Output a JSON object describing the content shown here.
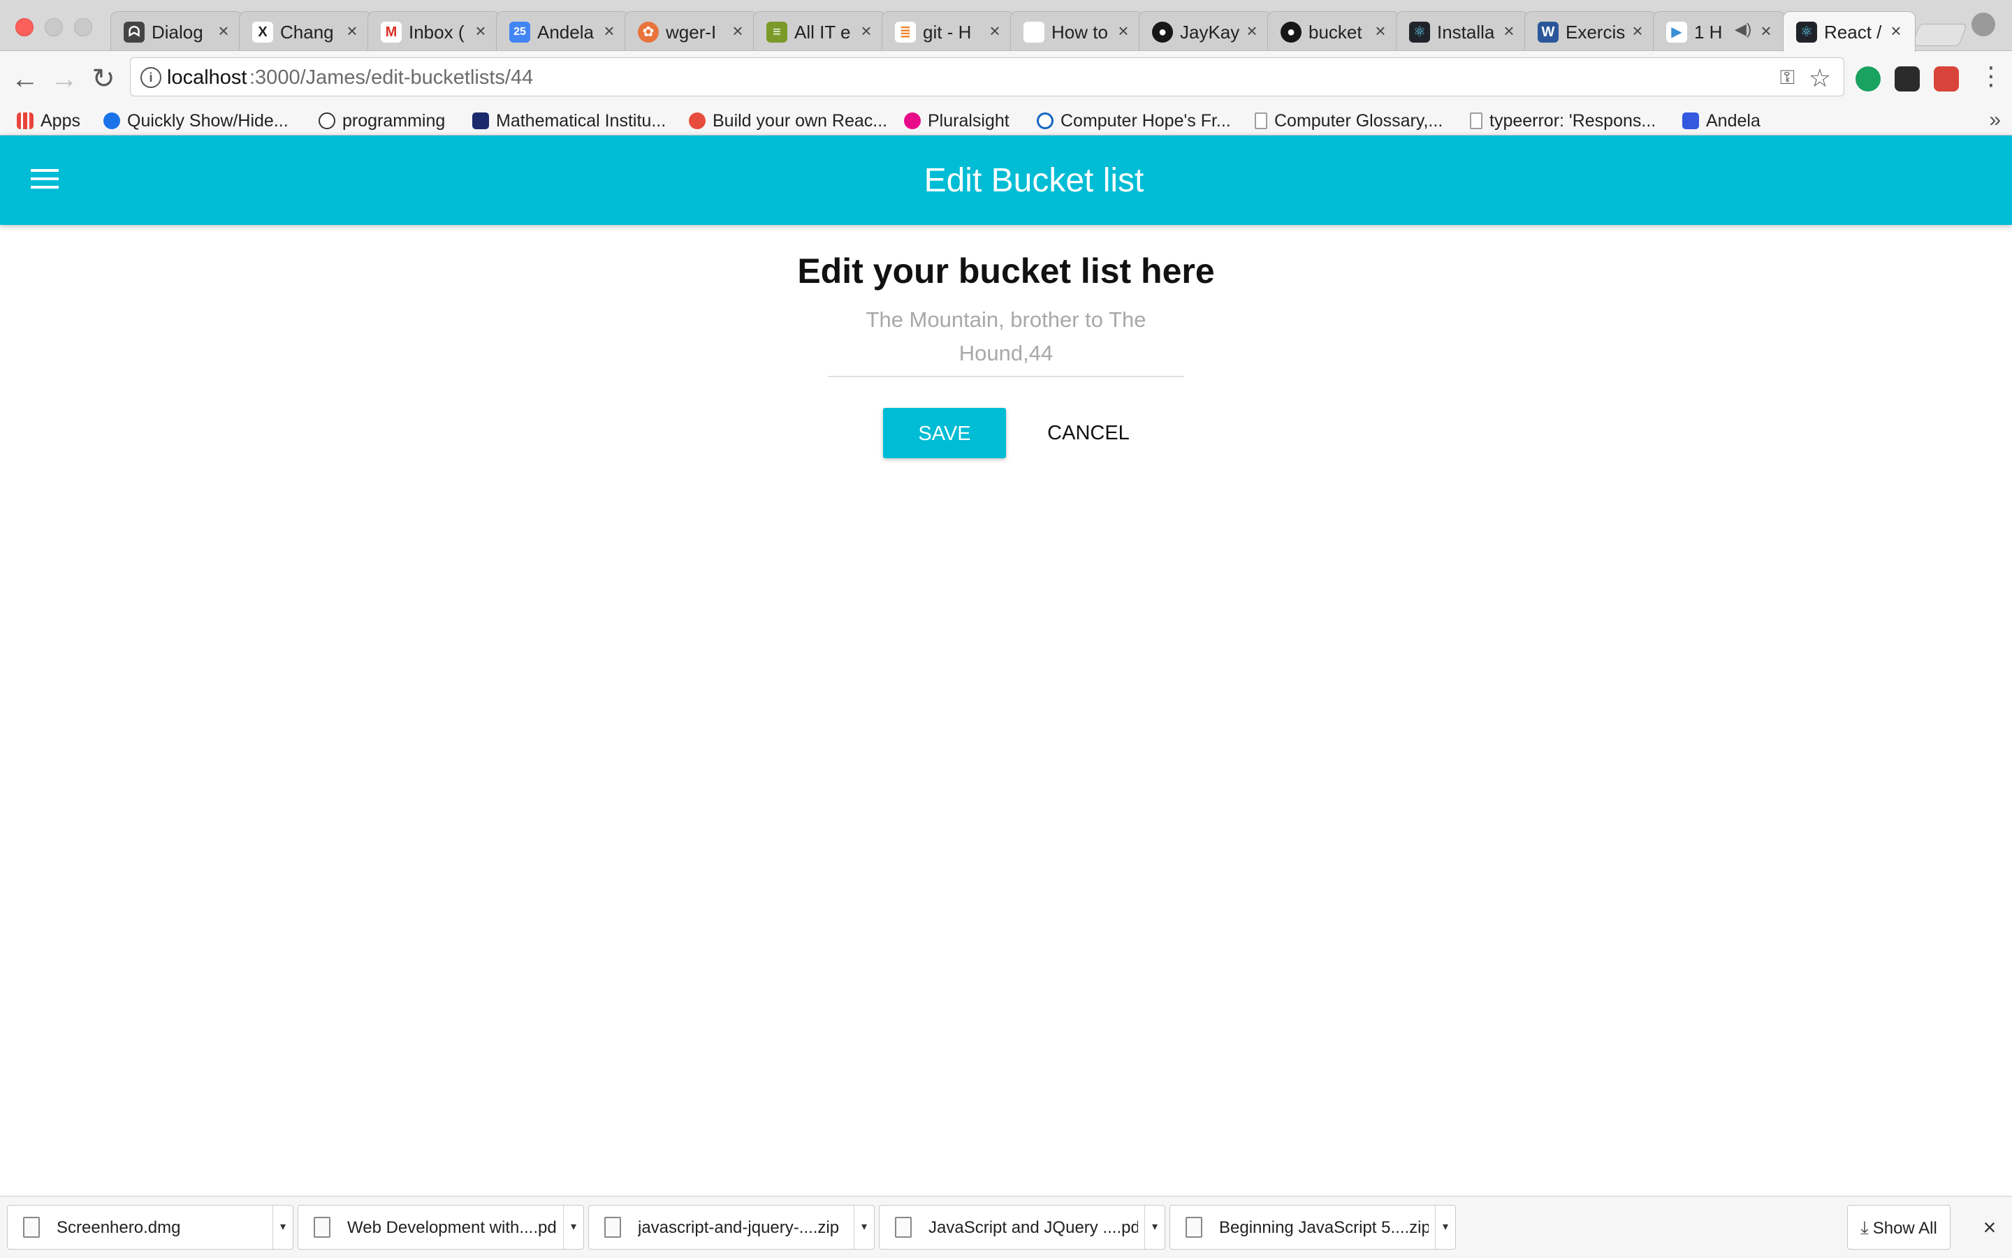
{
  "browser": {
    "tabs": [
      {
        "title": "Dialog",
        "icon": "dialog-favicon",
        "color": "#444444"
      },
      {
        "title": "Chang",
        "icon": "x-favicon",
        "color": "#222222"
      },
      {
        "title": "Inbox (",
        "icon": "gmail-favicon",
        "color": "#d93025"
      },
      {
        "title": "Andela",
        "icon": "calendar-favicon",
        "color": "#4285f4"
      },
      {
        "title": "wger-I",
        "icon": "wger-favicon",
        "color": "#e8743b"
      },
      {
        "title": "All IT e",
        "icon": "books-favicon",
        "color": "#7a9a2a"
      },
      {
        "title": "git - H",
        "icon": "stackoverflow-favicon",
        "color": "#f48024"
      },
      {
        "title": "How to",
        "icon": "apple-favicon",
        "color": "#555555"
      },
      {
        "title": "JayKay",
        "icon": "github-favicon",
        "color": "#181717"
      },
      {
        "title": "bucket",
        "icon": "github-favicon",
        "color": "#181717"
      },
      {
        "title": "Installa",
        "icon": "react-favicon",
        "color": "#20232a"
      },
      {
        "title": "Exercis",
        "icon": "word-favicon",
        "color": "#2b579a"
      },
      {
        "title": "1 H",
        "icon": "play-favicon",
        "color": "#3b8fd6"
      },
      {
        "title": "React /",
        "icon": "react-favicon",
        "color": "#20232a"
      }
    ],
    "url_host": "localhost",
    "url_path": ":3000/James/edit-bucketlists/44",
    "bookmarks": [
      {
        "label": "Apps",
        "icon": "apps-grid-icon",
        "color": "#e8453c"
      },
      {
        "label": "Quickly Show/Hide...",
        "icon": "chart-icon",
        "color": "#1a73e8"
      },
      {
        "label": "programming",
        "icon": "reddit-icon",
        "color": "#ff4500"
      },
      {
        "label": "Mathematical Institu...",
        "icon": "institute-icon",
        "color": "#1a2a6c"
      },
      {
        "label": "Build your own Reac...",
        "icon": "react-guide-icon",
        "color": "#e74c3c"
      },
      {
        "label": "Pluralsight",
        "icon": "pluralsight-icon",
        "color": "#e80a89"
      },
      {
        "label": "Computer Hope's Fr...",
        "icon": "computerhope-icon",
        "color": "#1565c0"
      },
      {
        "label": "Computer Glossary,...",
        "icon": "page-icon",
        "color": "#9e9e9e"
      },
      {
        "label": "typeerror: 'Respons...",
        "icon": "page-icon",
        "color": "#9e9e9e"
      },
      {
        "label": "Andela",
        "icon": "andela-icon",
        "color": "#3359df"
      }
    ],
    "more_bookmarks": "»"
  },
  "app": {
    "title": "Edit Bucket list",
    "accent_color": "#00bcd4"
  },
  "form": {
    "heading": "Edit your bucket list here",
    "field_hint": "The Mountain, brother to The Hound,44",
    "save_label": "SAVE",
    "cancel_label": "CANCEL"
  },
  "downloads": {
    "items": [
      {
        "name": "Screenhero.dmg"
      },
      {
        "name": "Web Development with....pdf"
      },
      {
        "name": "javascript-and-jquery-....zip"
      },
      {
        "name": "JavaScript and JQuery ....pdf"
      },
      {
        "name": "Beginning JavaScript 5....zip"
      }
    ],
    "show_all_label": "Show All"
  }
}
